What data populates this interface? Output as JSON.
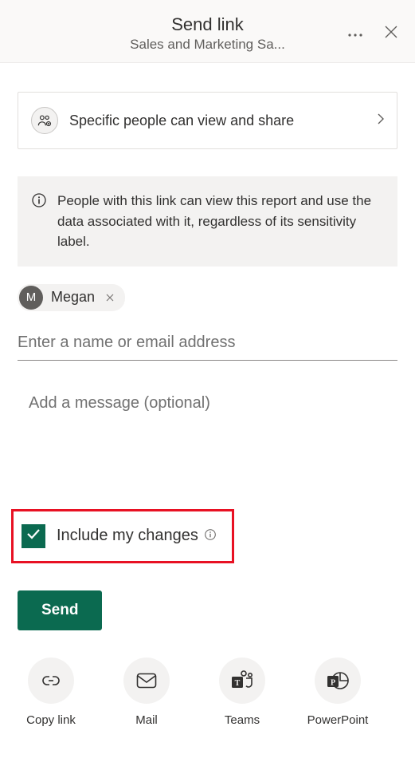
{
  "header": {
    "title": "Send link",
    "subtitle": "Sales and Marketing Sa..."
  },
  "permission": {
    "label": "Specific people can view and share"
  },
  "info": {
    "text": "People with this link can view this report and use the data associated with it, regardless of its sensitivity label."
  },
  "recipients": [
    {
      "name": "Megan",
      "initial": "M"
    }
  ],
  "nameInput": {
    "placeholder": "Enter a name or email address"
  },
  "messageInput": {
    "placeholder": "Add a message (optional)"
  },
  "includeChanges": {
    "label": "Include my changes",
    "checked": true
  },
  "sendButton": {
    "label": "Send"
  },
  "shareOptions": [
    {
      "id": "copy-link",
      "label": "Copy link"
    },
    {
      "id": "mail",
      "label": "Mail"
    },
    {
      "id": "teams",
      "label": "Teams"
    },
    {
      "id": "powerpoint",
      "label": "PowerPoint"
    }
  ]
}
